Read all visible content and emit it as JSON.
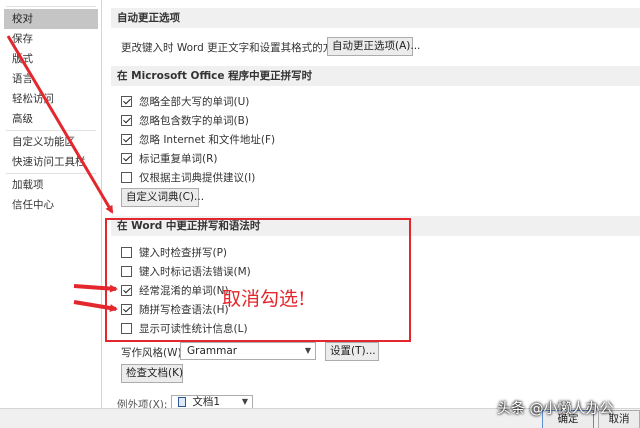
{
  "sidebar": {
    "items": [
      "校对",
      "保存",
      "版式",
      "语言",
      "轻松访问",
      "高级",
      "自定义功能区",
      "快速访问工具栏",
      "加载项",
      "信任中心"
    ],
    "active": "校对"
  },
  "autocorrect": {
    "header": "自动更正选项",
    "description": "更改键入时 Word 更正文字和设置其格式的方式:",
    "button": "自动更正选项(A)..."
  },
  "office_spelling": {
    "header": "在 Microsoft Office 程序中更正拼写时",
    "options": [
      {
        "label": "忽略全部大写的单词(U)",
        "checked": true
      },
      {
        "label": "忽略包含数字的单词(B)",
        "checked": true
      },
      {
        "label": "忽略 Internet 和文件地址(F)",
        "checked": true
      },
      {
        "label": "标记重复单词(R)",
        "checked": true
      },
      {
        "label": "仅根据主词典提供建议(I)",
        "checked": false
      }
    ],
    "custom_dict_button": "自定义词典(C)..."
  },
  "word_spelling": {
    "header": "在 Word 中更正拼写和语法时",
    "options": [
      {
        "label": "键入时检查拼写(P)",
        "checked": false
      },
      {
        "label": "键入时标记语法错误(M)",
        "checked": false
      },
      {
        "label": "经常混淆的单词(N)",
        "checked": true
      },
      {
        "label": "随拼写检查语法(H)",
        "checked": true
      },
      {
        "label": "显示可读性统计信息(L)",
        "checked": false
      }
    ],
    "style_label": "写作风格(W):",
    "style_value": "Grammar",
    "settings_button": "设置(T)...",
    "recheck_button": "检查文档(K)"
  },
  "exceptions": {
    "label": "例外项(X):",
    "value": "文档1"
  },
  "annotation": "取消勾选!",
  "footer": {
    "ok": "确定",
    "cancel": "取消"
  },
  "watermark": "头条 @小懒人办公",
  "colors": {
    "highlight": "#e3272d",
    "active_nav": "#c5c5c5",
    "section_header": "#f0f0f0"
  }
}
